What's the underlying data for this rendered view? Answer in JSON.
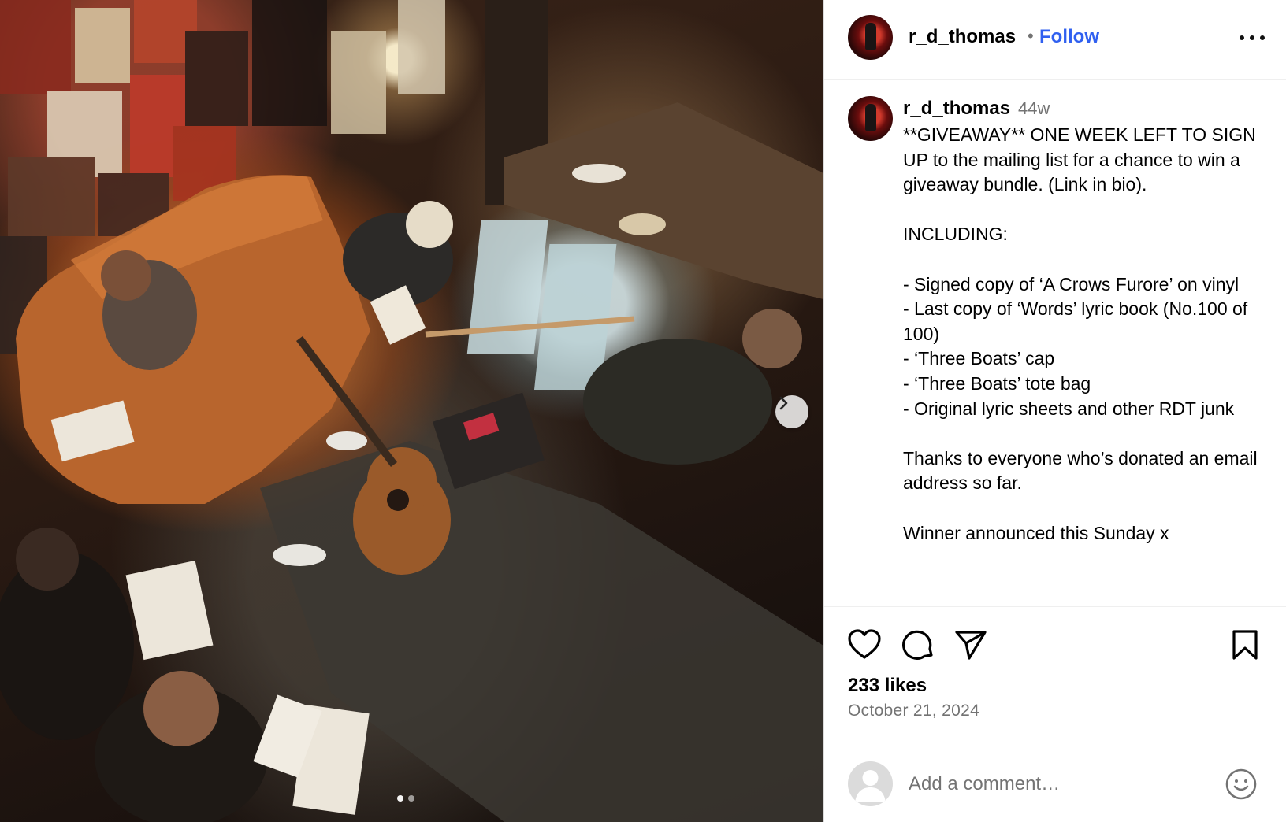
{
  "post": {
    "username": "r_d_thomas",
    "follow_label": "Follow",
    "separator": "•",
    "time_ago": "44w",
    "caption_lines": [
      "**GIVEAWAY** ONE WEEK LEFT TO SIGN UP to the mailing list for a chance to win a giveaway bundle. (Link in bio).",
      "",
      "INCLUDING:",
      "",
      "- Signed copy of ‘A Crows Furore’ on vinyl",
      "- Last copy of ‘Words’ lyric book (No.100 of 100)",
      "- ‘Three Boats’ cap",
      "- ‘Three Boats’ tote bag",
      "- Original lyric sheets and other RDT junk",
      "",
      "Thanks to everyone who’s donated an email address so far.",
      "",
      "Winner announced this Sunday x"
    ],
    "likes": "233 likes",
    "date": "October 21, 2024"
  },
  "comment": {
    "placeholder": "Add a comment…"
  },
  "carousel": {
    "dot_count": 2,
    "active_index": 0
  },
  "icons": {
    "like": "heart-icon",
    "comment": "comment-bubble-icon",
    "share": "paper-plane-icon",
    "save": "bookmark-icon",
    "next": "chevron-right-icon",
    "emoji": "smiley-icon",
    "more": "more-dots-icon"
  },
  "colors": {
    "follow": "#3060f0",
    "secondary_text": "#737373",
    "divider": "#efefef"
  }
}
